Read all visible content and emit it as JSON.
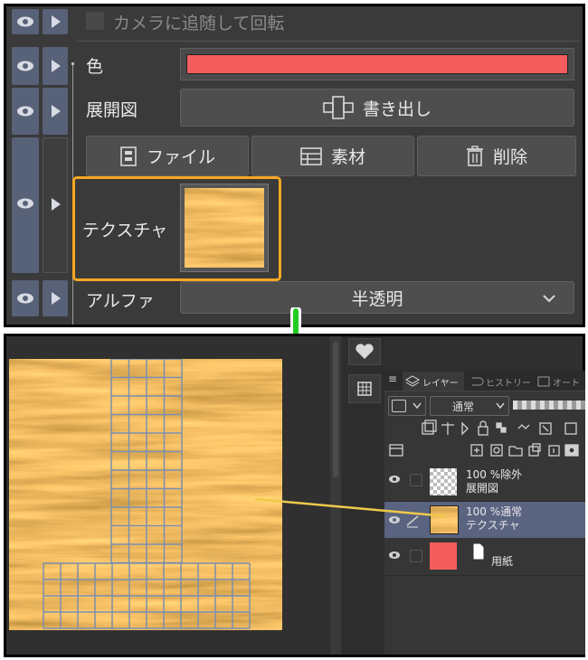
{
  "top_panel": {
    "rotate_label": "カメラに追随して回転",
    "color_label": "色",
    "color_value": "#f35d5d",
    "unfold_label": "展開図",
    "export_button": "書き出し",
    "file_button": "ファイル",
    "material_button": "素材",
    "delete_button": "削除",
    "texture_label": "テクスチャ",
    "alpha_label": "アルファ",
    "alpha_value": "半透明",
    "highlight_color": "#f5a623"
  },
  "bottom_panel": {
    "tabs": [
      "レイヤー",
      "ヒストリー",
      "オート"
    ],
    "blend_mode": "通常",
    "layers": [
      {
        "line1": "100 %除外",
        "line2": "展開図"
      },
      {
        "line1": "100 %通常",
        "line2": "テクスチャ"
      },
      {
        "line1": "",
        "line2": "用紙"
      }
    ],
    "selected_layer_color": "#5a6380",
    "paper_color": "#f35d5d",
    "connector_color": "#f0c94a",
    "arrow_color": "#22cc22"
  }
}
